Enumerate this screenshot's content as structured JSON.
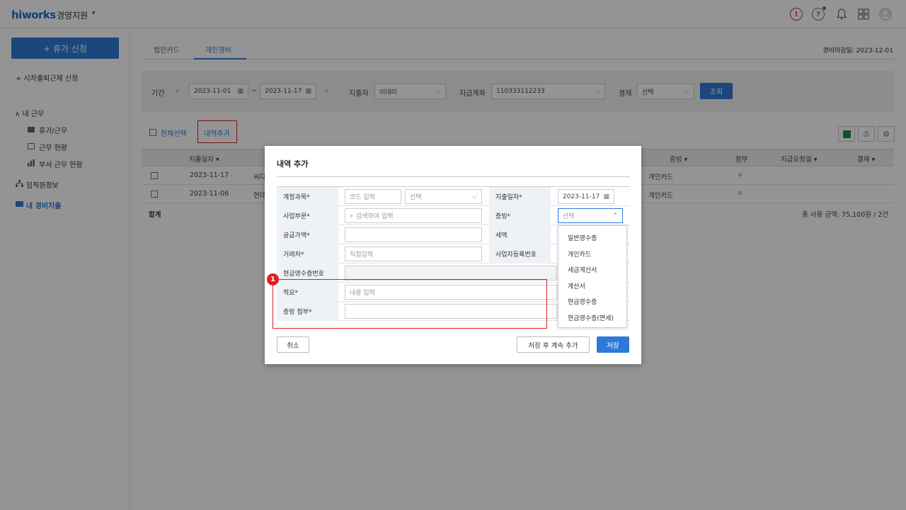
{
  "topbar": {
    "logo": "hiworks",
    "app": "경영지원",
    "caret": "▾"
  },
  "sidebar": {
    "primary_button": "+ 휴가 신청",
    "item_time": "+ 시차출퇴근제 신청",
    "section_my_work": "∧ 내 근무",
    "sub_vacation": "휴가/근무",
    "sub_status": "근무 현황",
    "sub_dept": "부서 근무 현황",
    "item_staff": "임직원정보",
    "item_expense": "내 경비지출"
  },
  "tabs": {
    "corp_card": "법인카드",
    "personal": "개인경비"
  },
  "deadline": "경비마감일: 2023-12-01",
  "filters": {
    "period_label": "기간",
    "date_from": "2023-11-01",
    "date_sep": "~",
    "date_to": "2023-11-17",
    "spender_label": "지출자",
    "spender_value": "이대리",
    "account_label": "지급계좌",
    "account_value": "110333112233",
    "approval_label": "결재",
    "approval_value": "선택",
    "search_button": "조회"
  },
  "actions": {
    "select_all": "전체선택",
    "add_item": "내역추가"
  },
  "table": {
    "headers": {
      "date": "지출일자 ▾",
      "proof": "증빙 ▾",
      "attach": "첨부",
      "request": "지급요청일 ▾",
      "approval": "결재 ▾"
    },
    "rows": [
      {
        "date": "2023-11-17",
        "item": "씨디",
        "proof": "개인카드"
      },
      {
        "date": "2023-11-06",
        "item": "현대",
        "proof": "개인카드"
      }
    ],
    "total_label": "합계",
    "total_value": "총 사용 금액: 75,100원 / 2건"
  },
  "modal": {
    "title": "내역 추가",
    "labels": {
      "account": "계정과목*",
      "business": "사업부문*",
      "supply": "공급가액*",
      "vendor": "거래처*",
      "cash_receipt": "현금영수증번호",
      "summary": "적요*",
      "attach": "증빙 첨부*",
      "spend_date": "지출일자*",
      "proof": "증빙*",
      "tax": "세액",
      "biz_no": "사업자등록번호"
    },
    "placeholders": {
      "code": "코드 입력",
      "select": "선택",
      "business": "검색하여 입력",
      "vendor": "직접입력",
      "summary": "내용 입력"
    },
    "values": {
      "spend_date": "2023-11-17",
      "proof_select": "선택"
    },
    "dropdown": [
      "일반영수증",
      "개인카드",
      "세금계산서",
      "계산서",
      "현금영수증",
      "현금영수증(면세)"
    ],
    "buttons": {
      "cancel": "취소",
      "save_continue": "저장 후 계속 추가",
      "save": "저장"
    }
  },
  "annotation": {
    "badge": "1"
  },
  "colors": {
    "accent": "#2f7ad8",
    "highlight": "#e02020"
  }
}
